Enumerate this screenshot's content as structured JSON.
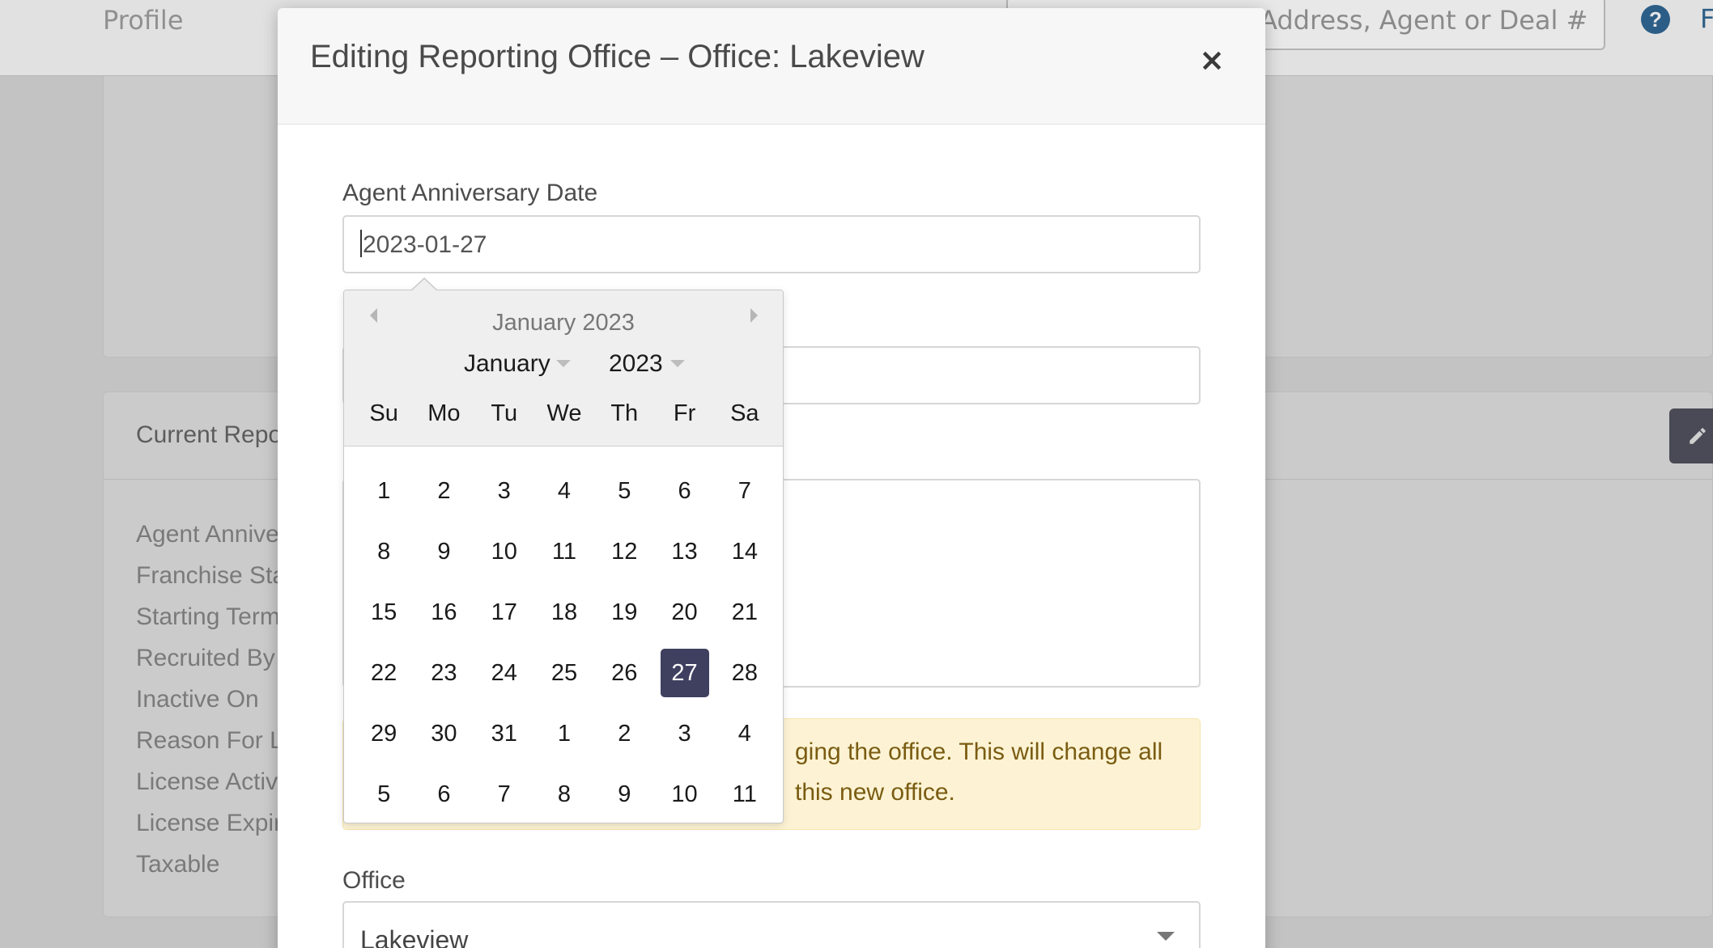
{
  "background": {
    "topbar": {
      "profile_label": "Profile",
      "search_visible_text": "Address, Agent or Deal #",
      "help_icon": "?",
      "right_edge_text": "F"
    },
    "panel": {
      "title": "Current Repo",
      "edit_icon": "pencil-icon",
      "field_labels": [
        "Agent Annive",
        "Franchise Sta",
        "Starting Term",
        "Recruited By",
        "Inactive On",
        "Reason For Le",
        "License Active",
        "License Expiry",
        "Taxable"
      ]
    }
  },
  "modal": {
    "title": "Editing Reporting Office – Office: Lakeview",
    "close_label": "×",
    "anniversary_label": "Agent Anniversary Date",
    "anniversary_value": "2023-01-27",
    "warning_line1": "ging the office. This will change all",
    "warning_line2": "this new office.",
    "office_label": "Office",
    "office_value": "Lakeview"
  },
  "datepicker": {
    "current_month": "January 2023",
    "month_select": "January",
    "year_select": "2023",
    "weekdays": [
      "Su",
      "Mo",
      "Tu",
      "We",
      "Th",
      "Fr",
      "Sa"
    ],
    "days": [
      "1",
      "2",
      "3",
      "4",
      "5",
      "6",
      "7",
      "8",
      "9",
      "10",
      "11",
      "12",
      "13",
      "14",
      "15",
      "16",
      "17",
      "18",
      "19",
      "20",
      "21",
      "22",
      "23",
      "24",
      "25",
      "26",
      "27",
      "28",
      "29",
      "30",
      "31",
      "1",
      "2",
      "3",
      "4",
      "5",
      "6",
      "7",
      "8",
      "9",
      "10",
      "11"
    ],
    "selected_day": "27",
    "accent_color": "#3f4060"
  }
}
